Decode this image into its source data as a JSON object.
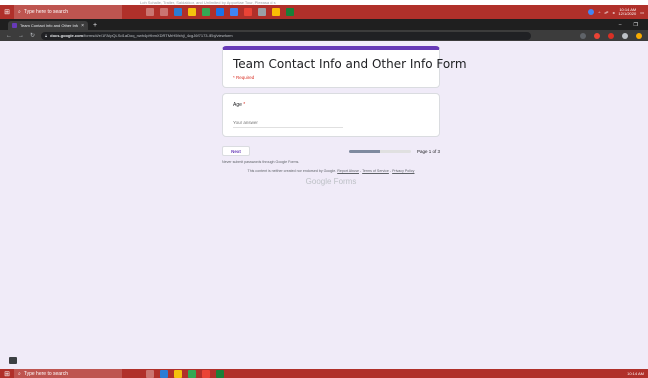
{
  "capture_strip": {
    "text": "Loh Schalle, Trailer, Saldakkor, and Unlimited by Apportiae Tour, Pleeasa d s"
  },
  "taskbar": {
    "search_placeholder": "Type here to search",
    "tray_time": "10:14 AM",
    "tray_date": "12/1/2020"
  },
  "browser": {
    "tab_title": "Team Contact Info and Other Info",
    "url_domain": "docs.google.com",
    "url_path": "/forms/d/e/1FAIpQLSd1aDoq_nwh4pHbmXDRTMrH5fxhjl_4cgJ6f7173-lEbj/viewform"
  },
  "form": {
    "title": "Team Contact Info and Other Info Form",
    "required_note": "* Required",
    "question_label": "Age",
    "question_required_mark": " *",
    "answer_placeholder": "Your answer",
    "next_label": "Next",
    "progress_fraction": 0.5,
    "progress_text": "Page 1 of 3",
    "password_note": "Never submit passwords through Google Forms.",
    "footer_prefix": "This content is neither created nor endorsed by Google.",
    "report_abuse": "Report Abuse",
    "terms": "Terms of Service",
    "privacy": "Privacy Policy",
    "logo_text": "Google Forms"
  },
  "colors": {
    "background": "#f0ebf8",
    "accent": "#673ab7",
    "taskbar": "#b0302a",
    "required": "#d93025"
  }
}
